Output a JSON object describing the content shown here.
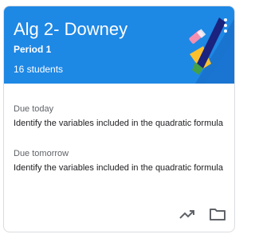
{
  "class_card": {
    "title": "Alg 2- Downey",
    "section": "Period 1",
    "students": "16 students",
    "header_color": "#1e88e5",
    "menu_icon": "more-vert-icon"
  },
  "assignments": [
    {
      "due_label": "Due today",
      "title": "Identify the variables included in the quadratic formula"
    },
    {
      "due_label": "Due tomorrow",
      "title": "Identify the variables included in the quadratic formula"
    }
  ],
  "footer": {
    "icons": [
      "trending-up-icon",
      "folder-icon"
    ]
  }
}
